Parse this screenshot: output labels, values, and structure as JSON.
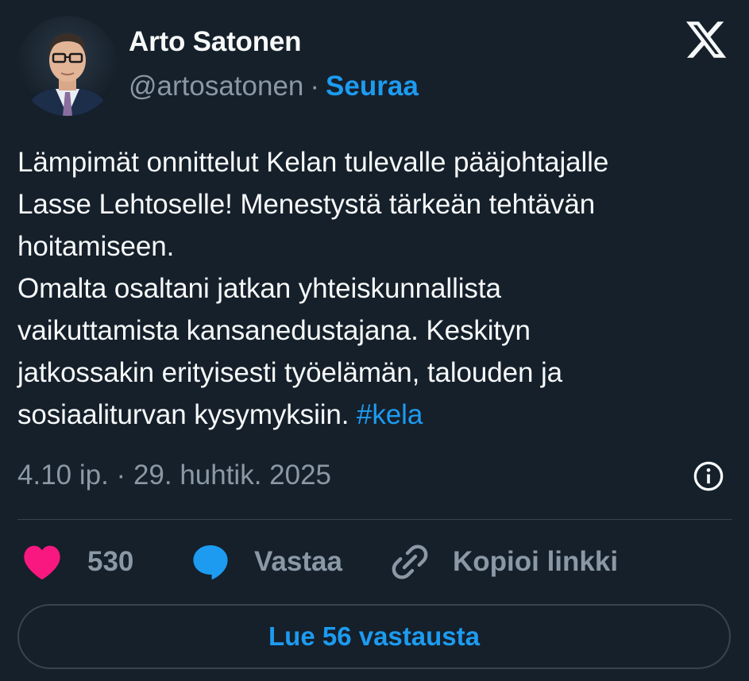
{
  "author": {
    "display_name": "Arto Satonen",
    "handle": "@artosatonen",
    "separator": "·",
    "follow_label": "Seuraa"
  },
  "tweet": {
    "lines": [
      "Lämpimät onnittelut Kelan tulevalle  pääjohtajalle",
      "Lasse Lehtoselle! Menestystä tärkeän tehtävän",
      "hoitamiseen.",
      "Omalta osaltani jatkan yhteiskunnallista",
      "vaikuttamista kansanedustajana. Keskityn",
      "jatkossakin erityisesti työelämän, talouden ja",
      "sosiaaliturvan kysymyksiin. "
    ],
    "hashtag": "#kela"
  },
  "meta": {
    "time": "4.10 ip.",
    "separator": "·",
    "date": "29. huhtik. 2025"
  },
  "actions": {
    "like_count": "530",
    "reply_label": "Vastaa",
    "copy_link_label": "Kopioi linkki"
  },
  "read_replies_label": "Lue 56 vastausta",
  "icons": {
    "logo": "x-logo-icon",
    "info": "info-icon",
    "like": "heart-icon",
    "reply": "speech-bubble-icon",
    "copy": "link-icon"
  },
  "colors": {
    "background": "#15202b",
    "text": "#f7f9f9",
    "muted": "#8b98a5",
    "accent": "#1d9bf0",
    "like": "#f91880",
    "border": "#38444d"
  }
}
